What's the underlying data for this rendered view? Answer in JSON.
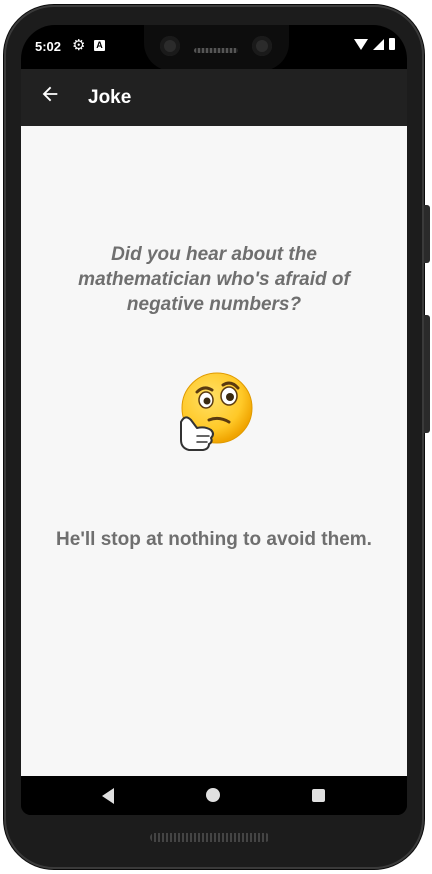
{
  "status_bar": {
    "time": "5:02",
    "icons": [
      "settings-icon",
      "a-notification-icon",
      "wifi-icon",
      "signal-icon",
      "battery-icon"
    ]
  },
  "app_bar": {
    "title": "Joke",
    "back_icon": "arrow-left-icon",
    "background": "#212121"
  },
  "joke": {
    "question": "Did you hear about the mathematician who's afraid of negative numbers?",
    "emoji": "thinking-face",
    "answer": "He'll stop at nothing to avoid them.",
    "text_color": "#6f6f6f"
  },
  "nav_bar": {
    "icons": [
      "back-triangle-icon",
      "home-circle-icon",
      "recents-square-icon"
    ]
  }
}
